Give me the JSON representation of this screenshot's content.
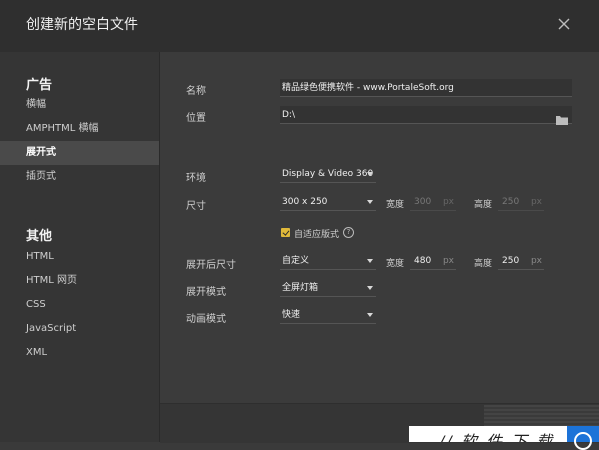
{
  "dialog": {
    "title": "创建新的空白文件",
    "close_icon": "close-icon"
  },
  "sidebar": {
    "section_ads": "广告",
    "ads_items": [
      "横幅",
      "AMPHTML 横幅",
      "展开式",
      "插页式"
    ],
    "active_item": "展开式",
    "section_other": "其他",
    "other_items": [
      "HTML",
      "HTML 网页",
      "CSS",
      "JavaScript",
      "XML"
    ]
  },
  "form": {
    "name_label": "名称",
    "name_value": "精品绿色便携软件 - www.PortaleSoft.org",
    "location_label": "位置",
    "location_value": "D:\\",
    "folder_icon": "folder-icon",
    "env_label": "环境",
    "env_value": "Display & Video 360",
    "size_label": "尺寸",
    "size_value": "300 x 250",
    "width_label": "宽度",
    "height_label": "高度",
    "size_width": "300",
    "size_height": "250",
    "unit": "px",
    "responsive_label": "自适应版式",
    "responsive_checked": true,
    "expanded_size_label": "展开后尺寸",
    "expanded_size_value": "自定义",
    "expanded_width": "480",
    "expanded_height": "250",
    "expand_mode_label": "展开模式",
    "expand_mode_value": "全屏灯箱",
    "animation_mode_label": "动画模式",
    "animation_mode_value": "快速"
  },
  "watermark": {
    "text": "// 软 件 下 载"
  },
  "colors": {
    "accent": "#e0b93a",
    "active_bg": "#4a4a4a",
    "badge": "#1c73d8"
  }
}
